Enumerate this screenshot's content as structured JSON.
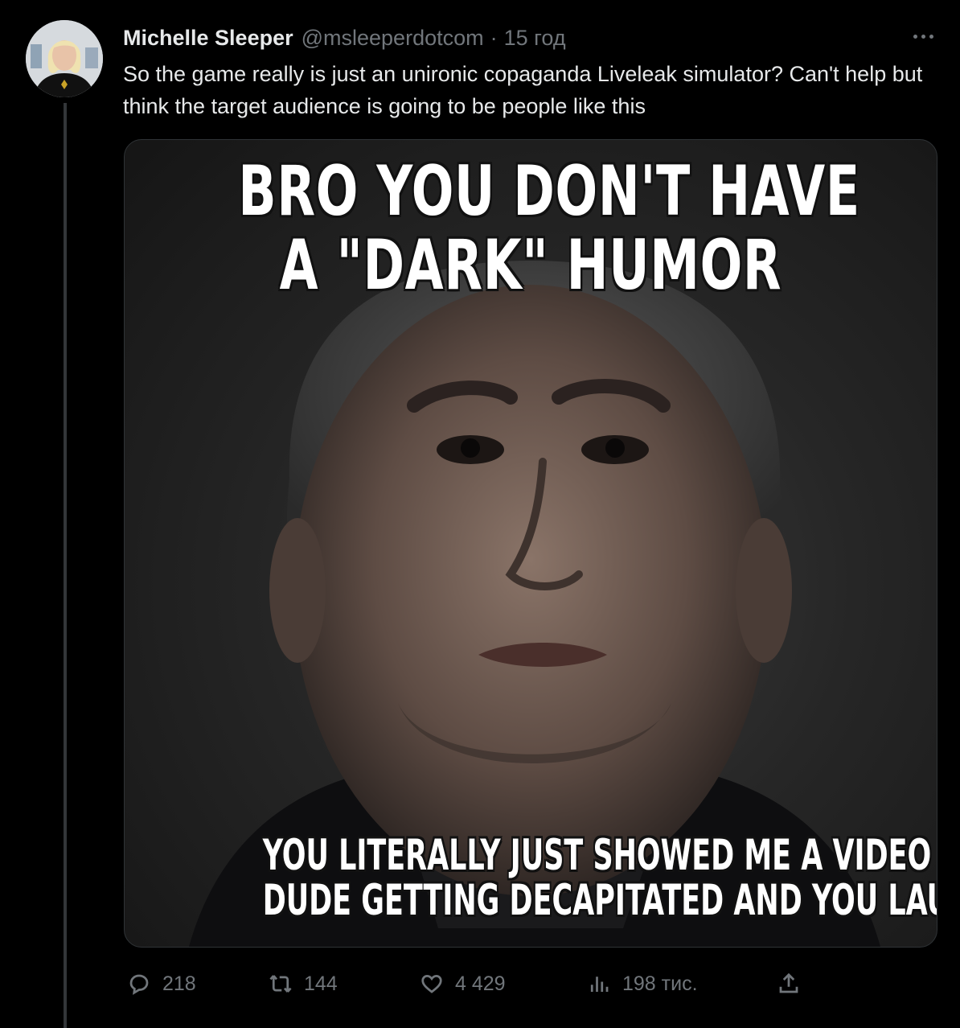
{
  "tweet": {
    "display_name": "Michelle Sleeper",
    "handle": "@msleeperdotcom",
    "separator": "·",
    "time": "15 год",
    "text": "So the game really is just an unironic copaganda Liveleak simulator? Can't help but think the target audience is going to be people like this"
  },
  "media": {
    "top_caption_lines": [
      "BRO YOU DON'T HAVE",
      "A \"DARK\" HUMOR"
    ],
    "bottom_caption_lines": [
      "YOU LITERALLY JUST SHOWED ME A VIDEO OF A",
      "DUDE GETTING DECAPITATED AND YOU LAUGHED"
    ]
  },
  "actions": {
    "replies": "218",
    "retweets": "144",
    "likes": "4 429",
    "views": "198 тис."
  },
  "icons": {
    "more": "more-horizontal-icon",
    "reply": "reply-icon",
    "retweet": "retweet-icon",
    "like": "heart-icon",
    "views": "views-chart-icon",
    "share": "share-icon"
  },
  "colors": {
    "background": "#000000",
    "primary_text": "#e7e9ea",
    "secondary_text": "#71767b",
    "border": "#2f3336"
  }
}
